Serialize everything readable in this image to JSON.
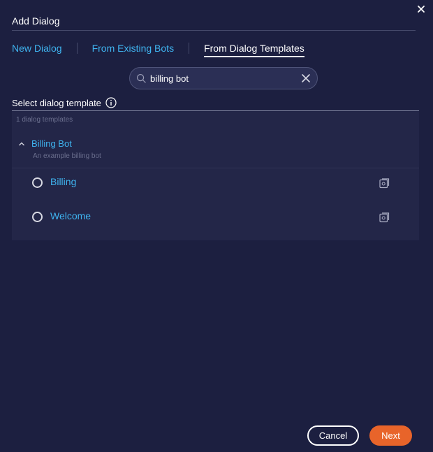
{
  "dialog": {
    "title": "Add Dialog"
  },
  "tabs": [
    {
      "label": "New Dialog",
      "active": false
    },
    {
      "label": "From Existing Bots",
      "active": false
    },
    {
      "label": "From Dialog Templates",
      "active": true
    }
  ],
  "search": {
    "value": "billing bot",
    "placeholder": ""
  },
  "section": {
    "label": "Select dialog template"
  },
  "templates": {
    "count_text": "1 dialog templates",
    "groups": [
      {
        "name": "Billing Bot",
        "description": "An example billing bot",
        "expanded": true,
        "items": [
          {
            "name": "Billing",
            "selected": false
          },
          {
            "name": "Welcome",
            "selected": false
          }
        ]
      }
    ]
  },
  "footer": {
    "cancel_label": "Cancel",
    "next_label": "Next"
  },
  "colors": {
    "background": "#1c1f40",
    "panel": "#232648",
    "link": "#3fb4f0",
    "primary_button": "#e8642a",
    "muted_text": "#6b6f8e"
  },
  "icons": [
    "close-icon",
    "search-icon",
    "clear-icon",
    "info-icon",
    "chevron-up-icon",
    "preview-icon"
  ]
}
